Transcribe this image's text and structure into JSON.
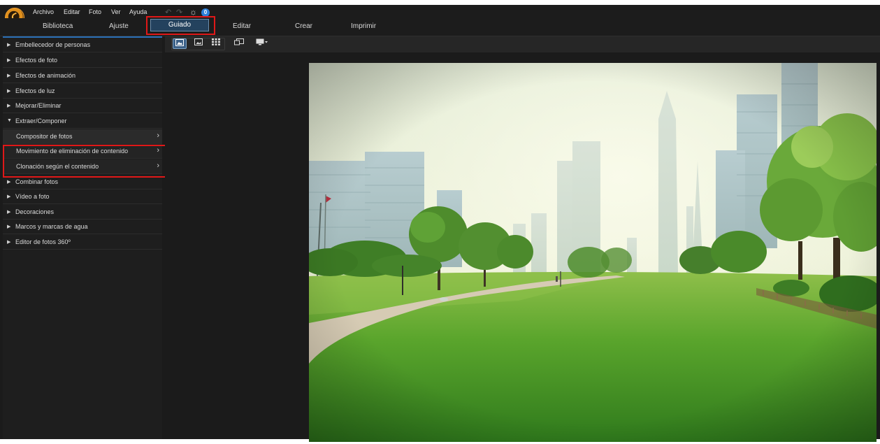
{
  "menu": {
    "items": [
      "Archivo",
      "Editar",
      "Foto",
      "Ver",
      "Ayuda"
    ]
  },
  "tabs": {
    "biblioteca": "Biblioteca",
    "ajuste": "Ajuste",
    "guiado": "Guiado",
    "editar": "Editar",
    "crear": "Crear",
    "imprimir": "Imprimir",
    "active": "Guiado"
  },
  "sidebar": {
    "items": [
      {
        "label": "Embellecedor de personas",
        "expanded": false
      },
      {
        "label": "Efectos de foto",
        "expanded": false
      },
      {
        "label": "Efectos de animación",
        "expanded": false
      },
      {
        "label": "Efectos de luz",
        "expanded": false
      },
      {
        "label": "Mejorar/Eliminar",
        "expanded": false
      },
      {
        "label": "Extraer/Componer",
        "expanded": true
      },
      {
        "label": "Combinar fotos",
        "expanded": false
      },
      {
        "label": "Vídeo a foto",
        "expanded": false
      },
      {
        "label": "Decoraciones",
        "expanded": false
      },
      {
        "label": "Marcos y marcas de agua",
        "expanded": false
      },
      {
        "label": "Editor de fotos 360º",
        "expanded": false
      }
    ],
    "subitems": [
      {
        "label": "Compositor de fotos",
        "selected": true
      },
      {
        "label": "Movimiento de eliminación de contenido",
        "selected": false
      },
      {
        "label": "Clonación según el contenido",
        "selected": false
      }
    ]
  },
  "icons": {
    "undo": "undo-icon",
    "redo": "redo-icon",
    "settings": "sun-gear-icon",
    "notifications": "notification-badge-icon",
    "logo": "app-logo-icon"
  },
  "notification_count": "0",
  "colors": {
    "accent": "#2a6fb6",
    "highlight_box": "#e01818",
    "active_tab_bg": "#24425e"
  }
}
